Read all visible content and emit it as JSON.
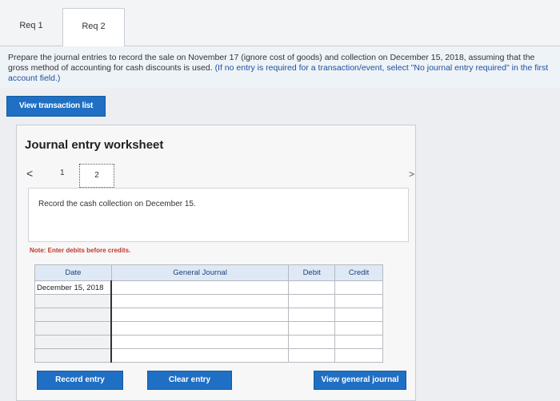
{
  "tabs": [
    {
      "label": "Req 1"
    },
    {
      "label": "Req 2"
    }
  ],
  "instructions": {
    "main": "Prepare the journal entries to record the sale on November 17 (ignore cost of goods) and collection on December 15, 2018, assuming that the gross method of accounting for cash discounts is used.",
    "note": "(If no entry is required for a transaction/event, select \"No journal entry required\" in the first account field.)"
  },
  "view_transaction_list": "View transaction list",
  "worksheet": {
    "title": "Journal entry worksheet",
    "pager": {
      "prev": "<",
      "page1": "1",
      "page2": "2",
      "next": ">"
    },
    "description": "Record the cash collection on December 15.",
    "note": "Note: Enter debits before credits.",
    "columns": [
      "Date",
      "General Journal",
      "Debit",
      "Credit"
    ],
    "rows": [
      {
        "date": "December 15, 2018",
        "account": "",
        "debit": "",
        "credit": ""
      },
      {
        "date": "",
        "account": "",
        "debit": "",
        "credit": ""
      },
      {
        "date": "",
        "account": "",
        "debit": "",
        "credit": ""
      },
      {
        "date": "",
        "account": "",
        "debit": "",
        "credit": ""
      },
      {
        "date": "",
        "account": "",
        "debit": "",
        "credit": ""
      },
      {
        "date": "",
        "account": "",
        "debit": "",
        "credit": ""
      }
    ]
  },
  "buttons": {
    "record": "Record entry",
    "clear": "Clear entry",
    "view_journal": "View general journal"
  },
  "colors": {
    "accent": "#1f6fc4",
    "note": "#c0392b"
  }
}
